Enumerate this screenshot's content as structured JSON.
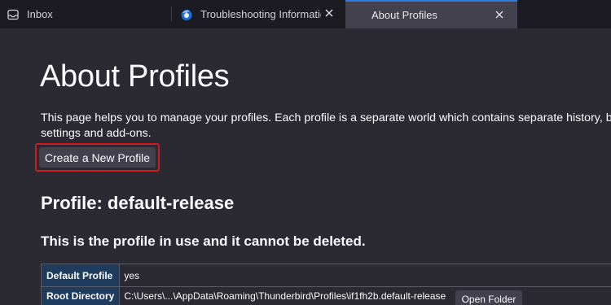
{
  "tabs": [
    {
      "label": "Inbox",
      "icon": "mail-inbox-icon",
      "active": false
    },
    {
      "label": "Troubleshooting Information",
      "icon": "firefox-page-icon",
      "active": false,
      "close": "✕"
    },
    {
      "label": "About Profiles",
      "icon": "",
      "active": true,
      "close": "✕"
    }
  ],
  "page": {
    "title": "About Profiles",
    "intro_line1": "This page helps you to manage your profiles. Each profile is a separate world which contains separate history, bookmarks,",
    "intro_line2": "settings and add-ons.",
    "create_button": "Create a New Profile",
    "highlight_color": "#d01a22"
  },
  "profile": {
    "heading": "Profile: default-release",
    "note": "This is the profile in use and it cannot be deleted.",
    "rows": [
      {
        "label": "Default Profile",
        "value": "yes"
      },
      {
        "label": "Root Directory",
        "value": "C:\\Users\\...\\AppData\\Roaming\\Thunderbird\\Profiles\\if1fh2b.default-release",
        "action": "Open Folder"
      }
    ]
  },
  "colors": {
    "accent": "#2d7de0",
    "table_header": "#1f3b5e",
    "background": "#2b2a33"
  }
}
